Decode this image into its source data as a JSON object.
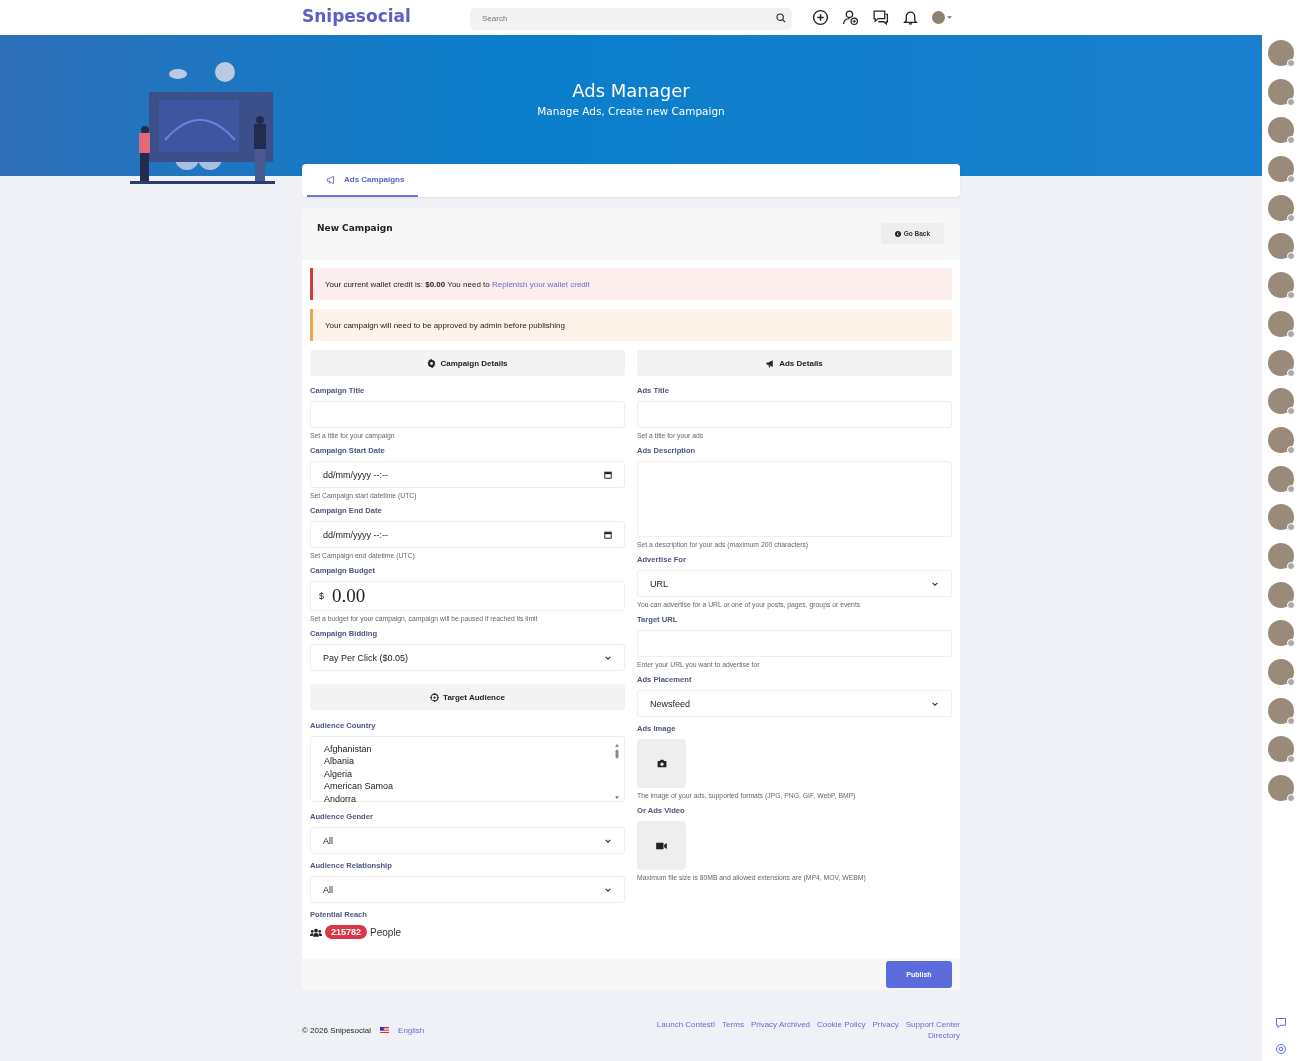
{
  "header": {
    "logo": "Snipesocial",
    "search": {
      "placeholder": "Search"
    }
  },
  "banner": {
    "title": "Ads Manager",
    "subtitle": "Manage Ads, Create new Campaign"
  },
  "tabs": [
    {
      "label": "Ads Campaigns",
      "selected": true
    }
  ],
  "form": {
    "title": "New Campaign",
    "back_button": "Go Back",
    "alerts": [
      {
        "kind": "danger",
        "text": "Your current wallet credit is: **$0.00** You need to",
        "link": "Replenish your wallet credit"
      },
      {
        "kind": "warning",
        "text": "Your campaign will need to be approved by admin before publishing"
      }
    ],
    "left_column": [
      {
        "kind": "section",
        "label": "Campaign Details"
      },
      {
        "kind": "text",
        "label": "Campaign Title",
        "hint": "Set a title for your campaign"
      },
      {
        "kind": "date",
        "label": "Campaign Start Date",
        "value": "dd/mm/yyyy --:--",
        "hint": "Set Campaign start datetime (UTC)"
      },
      {
        "kind": "date",
        "label": "Campaign End Date",
        "value": "dd/mm/yyyy --:--",
        "hint": "Set Campaign end datetime (UTC)"
      },
      {
        "kind": "budget",
        "label": "Campaign Budget",
        "prefix": "$",
        "value": "0.00",
        "hint": "Set a budget for your campaign, campaign will be paused if reached its limit"
      },
      {
        "kind": "select",
        "label": "Campaign Bidding",
        "value": "Pay Per Click ($0.05)"
      },
      {
        "kind": "section",
        "label": "Target Audience"
      },
      {
        "kind": "listbox",
        "label": "Audience Country",
        "options": [
          "Afghanistan",
          "Albania",
          "Algeria",
          "American Samoa",
          "Andorra"
        ]
      },
      {
        "kind": "select",
        "label": "Audience Gender",
        "value": "All"
      },
      {
        "kind": "select",
        "label": "Audience Relationship",
        "value": "All"
      },
      {
        "kind": "reach",
        "label": "Potential Reach",
        "count": "215782",
        "unit": "People"
      }
    ],
    "right_column": [
      {
        "kind": "section",
        "label": "Ads Details"
      },
      {
        "kind": "text",
        "label": "Ads Title",
        "hint": "Set a title for your ads"
      },
      {
        "kind": "textarea",
        "label": "Ads Description",
        "hint": "Set a description for your ads (maximum 200 characters)"
      },
      {
        "kind": "select",
        "label": "Advertise For",
        "value": "URL",
        "hint": "You can advertise for a URL or one of your posts, pages, groups or events"
      },
      {
        "kind": "text",
        "label": "Target URL",
        "hint": "Enter your URL you want to advertise for"
      },
      {
        "kind": "select",
        "label": "Ads Placement",
        "value": "Newsfeed"
      },
      {
        "kind": "image_upload",
        "label": "Ads Image",
        "hint": "The image of your ads, supported formats (JPG, PNG, GIF, WebP, BMP)"
      },
      {
        "kind": "video_upload",
        "label": "Or Ads Video",
        "hint": "Maximum file size is 80MB and allowed extensions are (MP4, MOV, WEBM)"
      }
    ],
    "submit_button": "Publish"
  },
  "footer": {
    "copyright": "© 2026 Snipesocial",
    "language": "English",
    "links": [
      "Launch Contest!",
      "Terms",
      "Privacy Archived",
      "Cookie Policy",
      "Privacy",
      "Support Center",
      "Directory"
    ]
  }
}
